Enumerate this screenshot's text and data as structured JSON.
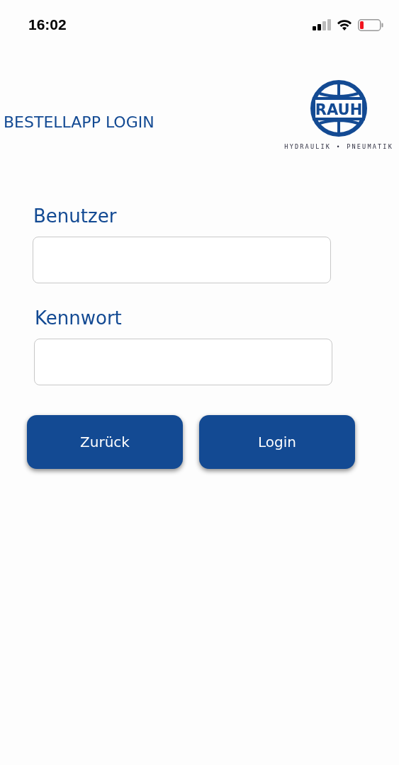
{
  "status_bar": {
    "time": "16:02"
  },
  "header": {
    "title": "BESTELLAPP LOGIN",
    "logo": {
      "wordmark": "RAUH",
      "tagline": "HYDRAULIK • PNEUMATIK"
    }
  },
  "form": {
    "fields": [
      {
        "label": "Benutzer"
      },
      {
        "label": "Kennwort"
      }
    ],
    "buttons": [
      {
        "label": "Zurück"
      },
      {
        "label": "Login"
      }
    ]
  }
}
